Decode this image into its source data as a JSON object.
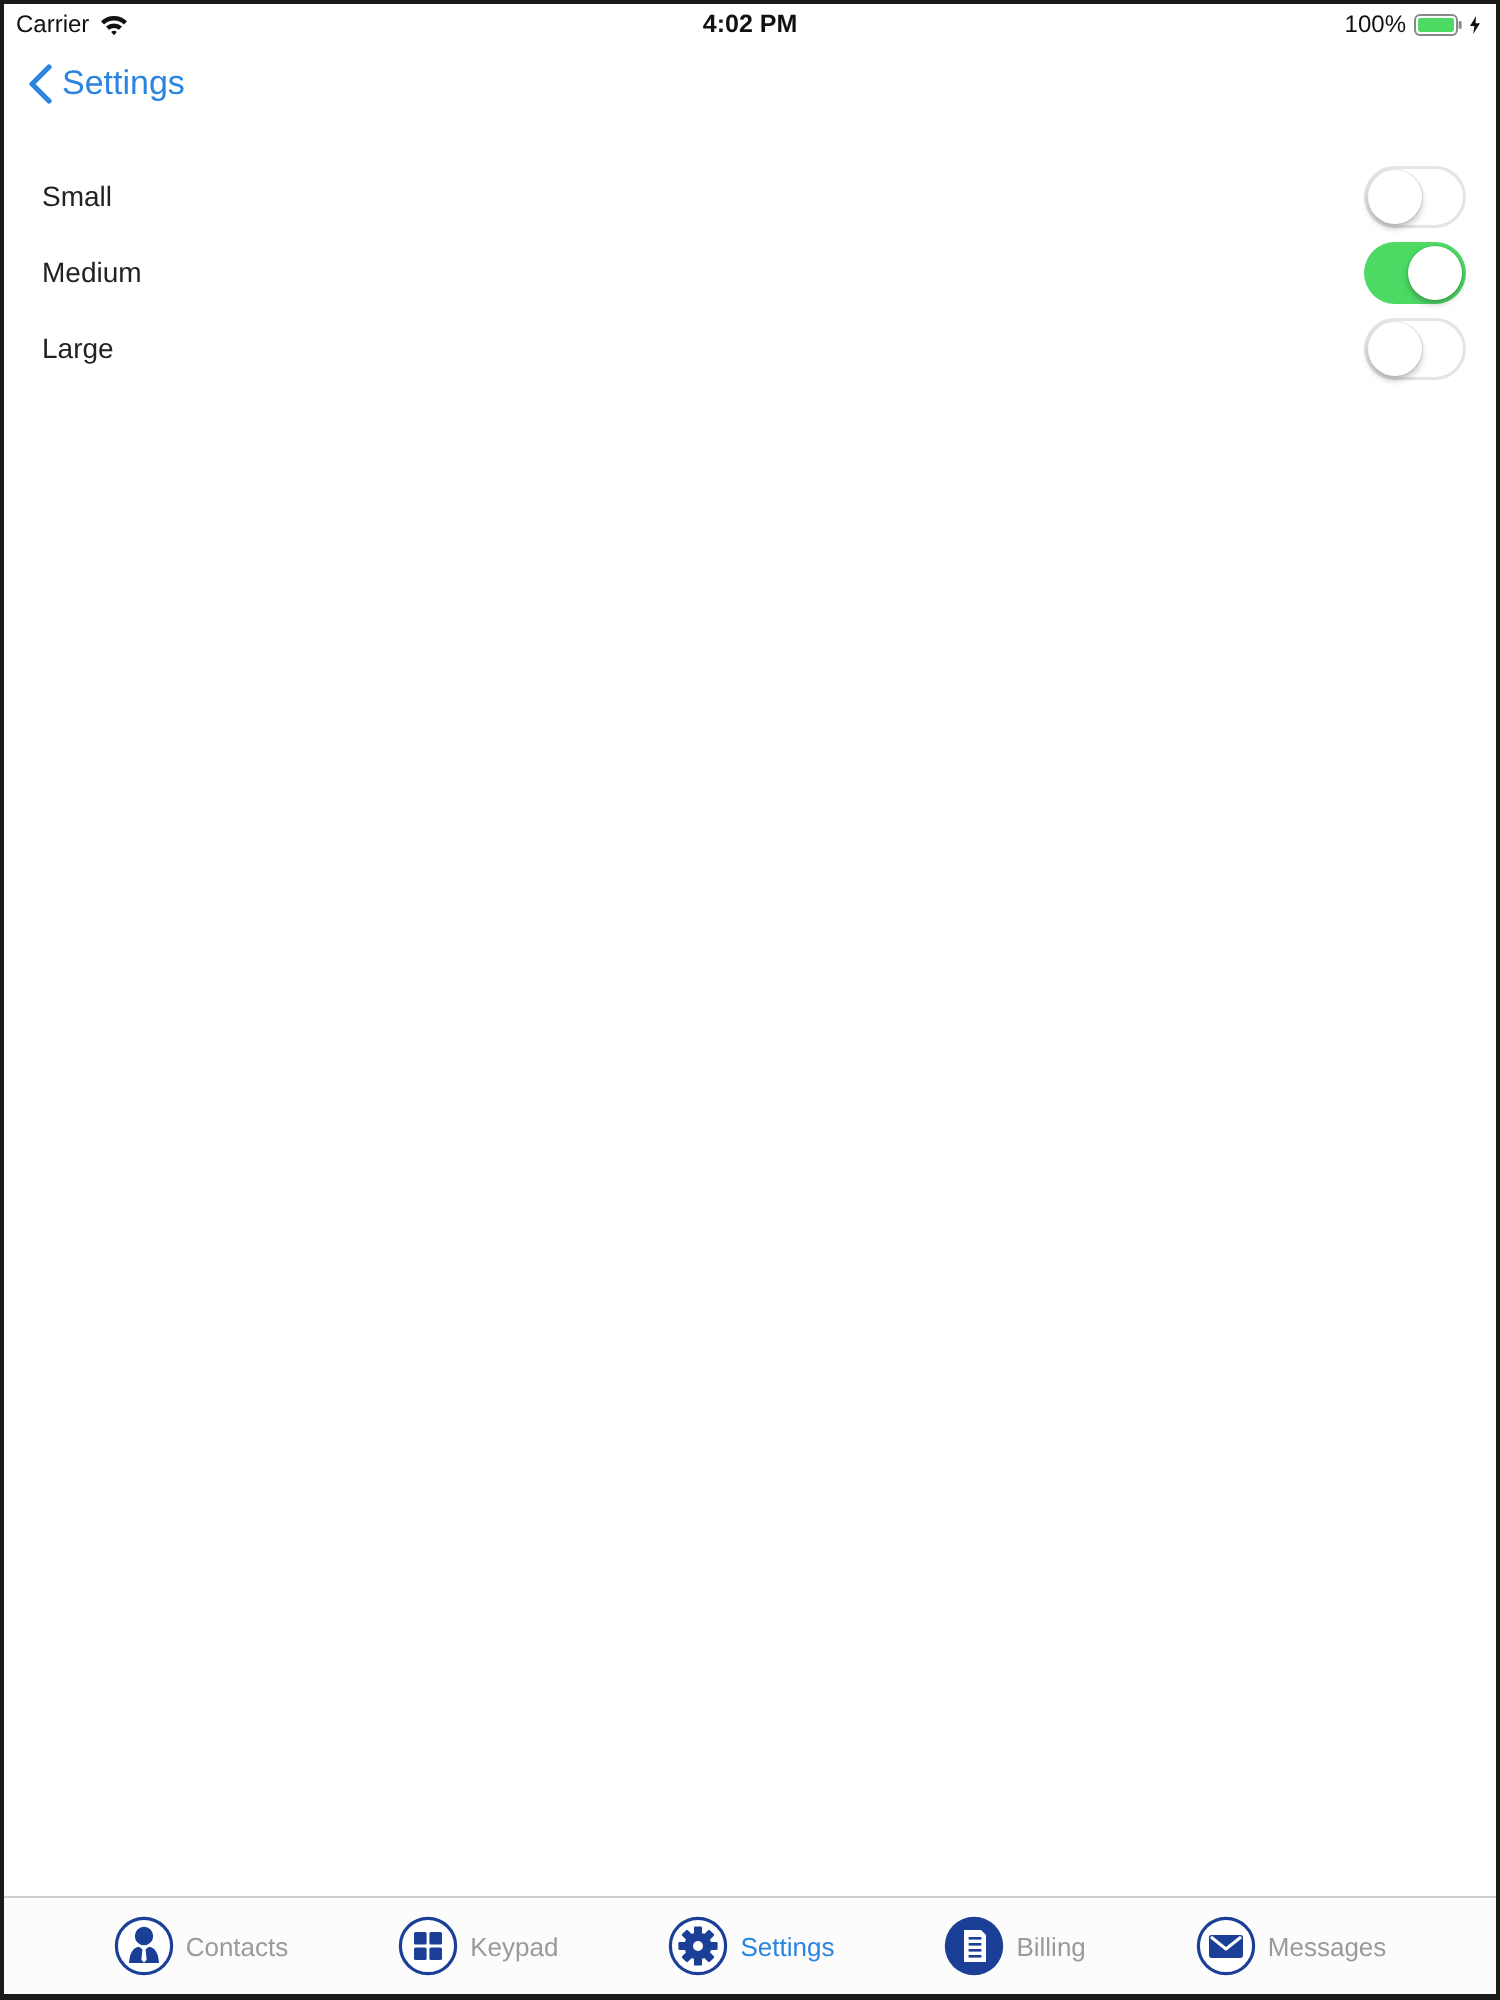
{
  "status_bar": {
    "carrier": "Carrier",
    "time": "4:02 PM",
    "battery": "100%"
  },
  "nav_bar": {
    "back_label": "Settings"
  },
  "options": [
    {
      "label": "Small",
      "on": false
    },
    {
      "label": "Medium",
      "on": true
    },
    {
      "label": "Large",
      "on": false
    }
  ],
  "tab_bar": {
    "tabs": [
      {
        "label": "Contacts",
        "selected": false
      },
      {
        "label": "Keypad",
        "selected": false
      },
      {
        "label": "Settings",
        "selected": true
      },
      {
        "label": "Billing",
        "selected": false
      },
      {
        "label": "Messages",
        "selected": false
      }
    ]
  }
}
